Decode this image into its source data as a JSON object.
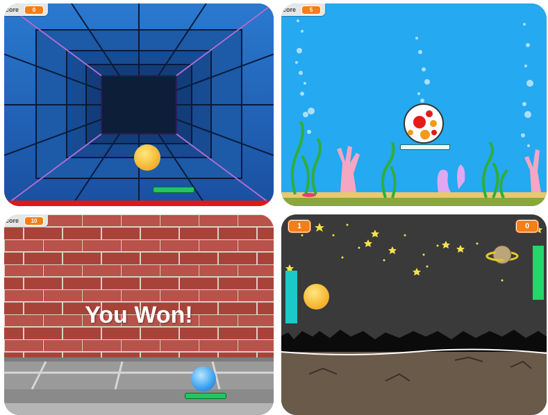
{
  "panels": {
    "tunnel": {
      "score_label": "core",
      "score_value": "0"
    },
    "ocean": {
      "score_label": "core",
      "score_value": "5"
    },
    "brick": {
      "score_label": "core",
      "score_value": "10",
      "message": "You Won!"
    },
    "space": {
      "left_score": "1",
      "right_score": "0"
    }
  },
  "colors": {
    "score_orange": "#f57e16",
    "paddle_green": "#22c55e",
    "tunnel_blue": "#1a5bb3",
    "ocean_blue": "#25a9f0",
    "brick_red": "#b24a3e",
    "space_gray": "#3a3a3a",
    "paddle_teal": "#1cc9c9"
  }
}
